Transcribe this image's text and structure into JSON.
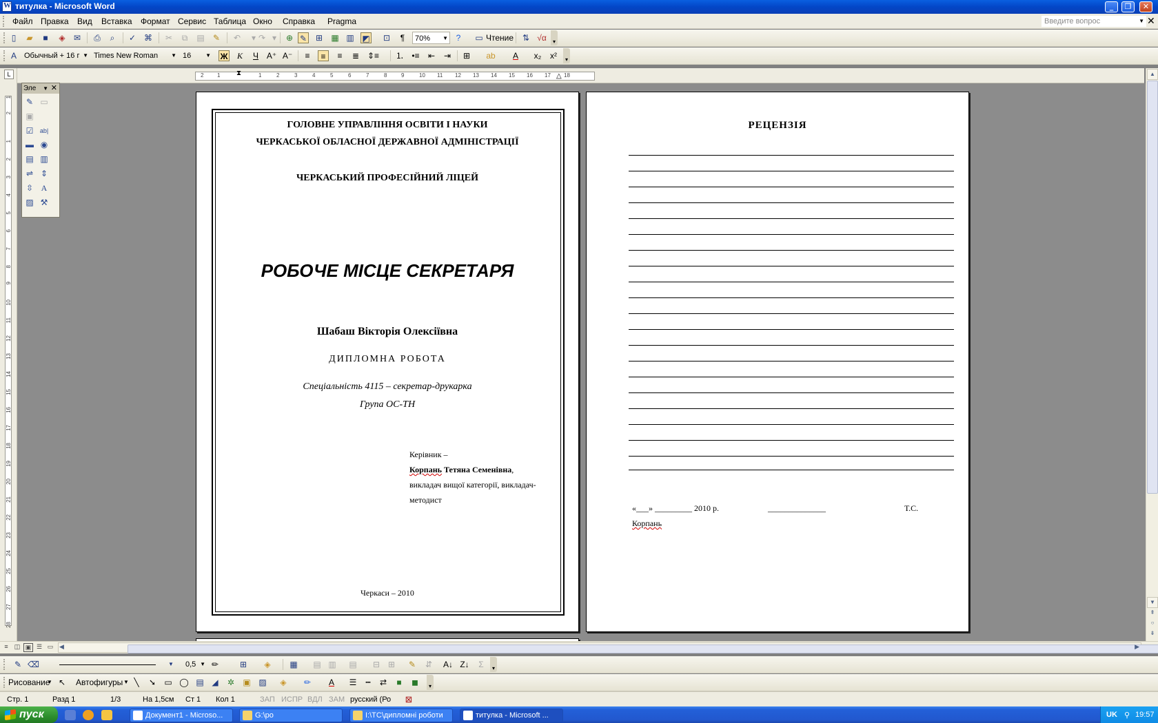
{
  "window": {
    "title": "титулка - Microsoft Word",
    "min": "_",
    "max": "❐",
    "close": "✕"
  },
  "menu": {
    "items": [
      "Файл",
      "Правка",
      "Вид",
      "Вставка",
      "Формат",
      "Сервис",
      "Таблица",
      "Окно",
      "Справка",
      "Pragma"
    ],
    "ask_placeholder": "Введите вопрос",
    "close": "✕"
  },
  "standard_toolbar": {
    "zoom": "70%",
    "reading_label": "Чтение"
  },
  "format_toolbar": {
    "style": "Обычный + 16 г",
    "font": "Times New Roman",
    "size": "16",
    "bold": "Ж",
    "italic": "К",
    "underline": "Ч"
  },
  "forms_toolbar": {
    "caption": "Эле"
  },
  "rulers": {
    "h_ticks": [
      "2",
      "1",
      "1",
      "2",
      "3",
      "4",
      "5",
      "6",
      "7",
      "8",
      "9",
      "10",
      "11",
      "12",
      "13",
      "14",
      "15",
      "16",
      "17",
      "18"
    ],
    "v_ticks": [
      "1",
      "2",
      "1",
      "2",
      "3",
      "4",
      "5",
      "6",
      "7",
      "8",
      "9",
      "10",
      "11",
      "12",
      "13",
      "14",
      "15",
      "16",
      "17",
      "18",
      "19",
      "20",
      "21",
      "22",
      "23",
      "24",
      "25",
      "26",
      "27",
      "28"
    ]
  },
  "page1": {
    "org_line1": "ГОЛОВНЕ УПРАВЛІННЯ ОСВІТИ І НАУКИ",
    "org_line2": "ЧЕРКАСЬКОЇ ОБЛАСНОЇ ДЕРЖАВНОЇ АДМІНІСТРАЦІЇ",
    "school": "ЧЕРКАСЬКИЙ ПРОФЕСІЙНИЙ ЛІЦЕЙ",
    "title": "РОБОЧЕ МІСЦЕ СЕКРЕТАРЯ",
    "author": "Шабаш Вікторія Олексіївна",
    "work_type": "ДИПЛОМНА РОБОТА",
    "specialty": "Спеціальність 4115  – секретар-друкарка",
    "group": "Група ОС-ТН",
    "supervisor_label": "Керівник –",
    "supervisor_surname": "Корпань",
    "supervisor_name": " Тетяна Семенівна",
    "supervisor_comma": ",",
    "supervisor_pos1": "викладач вищої категорії, викладач-",
    "supervisor_pos2": "методист",
    "city_year": "Черкаси – 2010"
  },
  "page2": {
    "title": "РЕЦЕНЗІЯ",
    "date_line": "«___» _________ 2010 р.",
    "signature_line": "______________",
    "initials": "Т.С.",
    "surname": "Корпань"
  },
  "drawing_toolbar": {
    "draw_label": "Рисование",
    "autoshapes_label": "Автофигуры",
    "line_width": "0,5"
  },
  "statusbar": {
    "page": "Стр.  1",
    "section": "Разд  1",
    "pages": "1/3",
    "at": "На  1,5см",
    "line": "Ст  1",
    "col": "Кол  1",
    "rec": "ЗАП",
    "trk": "ИСПР",
    "ext": "ВДЛ",
    "ovr": "ЗАМ",
    "lang": "русский (Ро"
  },
  "taskbar": {
    "start": "пуск",
    "items": [
      {
        "label": "Документ1 - Microso...",
        "active": false
      },
      {
        "label": "G:\\po",
        "active": false
      },
      {
        "label": "I:\\ТС\\дипломні роботи",
        "active": false
      },
      {
        "label": "титулка - Microsoft ...",
        "active": true
      }
    ],
    "lang": "UK",
    "time": "19:57"
  },
  "colors": {
    "titlebar": "#0a5fe0",
    "workspace": "#8c8c8c",
    "taskbar": "#2258cf",
    "start": "#2d8e2d"
  }
}
